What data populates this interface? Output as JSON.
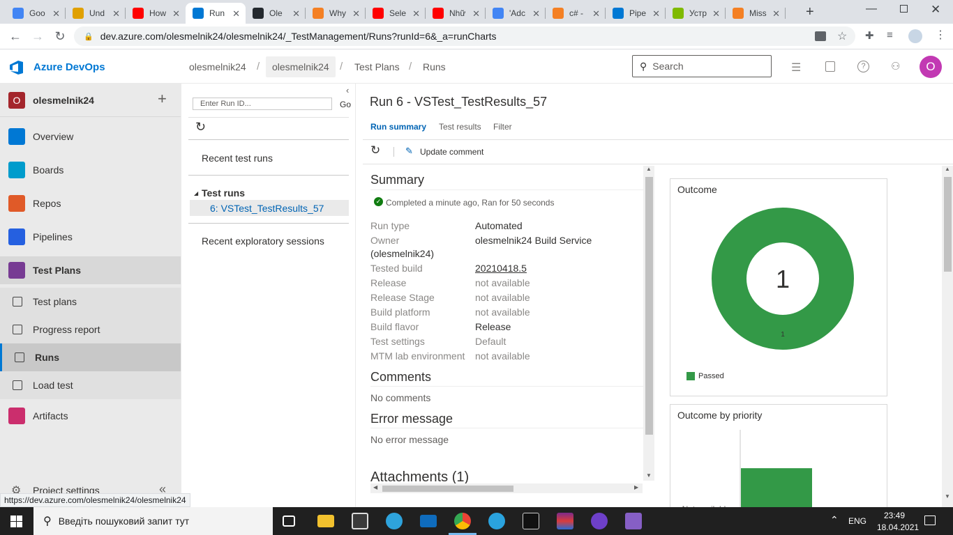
{
  "browser": {
    "tabs": [
      {
        "label": "Goo",
        "icon": "google-g-icon",
        "color": "#4285f4"
      },
      {
        "label": "Und",
        "icon": "chrome-icon",
        "color": "#e0a000"
      },
      {
        "label": "How",
        "icon": "youtube-icon",
        "color": "#ff0000"
      },
      {
        "label": "Run",
        "icon": "azure-devops-icon",
        "color": "#0078d4",
        "active": true
      },
      {
        "label": "Ole",
        "icon": "github-icon",
        "color": "#24292e"
      },
      {
        "label": "Why",
        "icon": "stackoverflow-icon",
        "color": "#f48024"
      },
      {
        "label": "Sele",
        "icon": "youtube-icon",
        "color": "#ff0000"
      },
      {
        "label": "Nhữ",
        "icon": "youtube-icon",
        "color": "#ff0000"
      },
      {
        "label": "'Adc",
        "icon": "google-g-icon",
        "color": "#4285f4"
      },
      {
        "label": "c# -",
        "icon": "stackoverflow-icon",
        "color": "#f48024"
      },
      {
        "label": "Pipe",
        "icon": "azure-devops-icon",
        "color": "#0078d4"
      },
      {
        "label": "Устр",
        "icon": "microsoft-icon",
        "color": "#7fba00"
      },
      {
        "label": "Miss",
        "icon": "stackoverflow-icon",
        "color": "#f48024"
      }
    ],
    "url": "dev.azure.com/olesmelnik24/olesmelnik24/_TestManagement/Runs?runId=6&_a=runCharts",
    "status_url": "https://dev.azure.com/olesmelnik24/olesmelnik24"
  },
  "header": {
    "product": "Azure DevOps",
    "breadcrumbs": [
      "olesmelnik24",
      "olesmelnik24",
      "Test Plans",
      "Runs"
    ],
    "search_placeholder": "Search",
    "avatar_letter": "O"
  },
  "sidebar": {
    "project": "olesmelnik24",
    "project_letter": "O",
    "items": [
      {
        "label": "Overview",
        "icon": "overview-icon",
        "color": "#0078d4"
      },
      {
        "label": "Boards",
        "icon": "boards-icon",
        "color": "#009ccc"
      },
      {
        "label": "Repos",
        "icon": "repos-icon",
        "color": "#e05a28"
      },
      {
        "label": "Pipelines",
        "icon": "pipelines-icon",
        "color": "#2560e0"
      },
      {
        "label": "Test Plans",
        "icon": "test-plans-icon",
        "color": "#773b93"
      }
    ],
    "subitems": [
      {
        "label": "Test plans",
        "icon": "test-plans-list-icon"
      },
      {
        "label": "Progress report",
        "icon": "progress-report-icon"
      },
      {
        "label": "Runs",
        "icon": "runs-icon"
      },
      {
        "label": "Load test",
        "icon": "load-test-icon"
      }
    ],
    "artifacts": {
      "label": "Artifacts",
      "icon": "artifacts-icon",
      "color": "#cb2e6d"
    },
    "settings": "Project settings"
  },
  "leftpanel": {
    "run_id_placeholder": "Enter Run ID...",
    "go_label": "Go",
    "recent_runs": "Recent test runs",
    "test_runs_header": "Test runs",
    "selected_run": "6: VSTest_TestResults_57",
    "recent_exploratory": "Recent exploratory sessions"
  },
  "content": {
    "title": "Run 6 - VSTest_TestResults_57",
    "tabs": [
      "Run summary",
      "Test results",
      "Filter"
    ],
    "update_comment": "Update comment",
    "summary_heading": "Summary",
    "status_text": "Completed a minute ago, Ran for 50 seconds",
    "fields": [
      {
        "label": "Run type",
        "value": "Automated"
      },
      {
        "label": "Owner",
        "value": "olesmelnik24 Build Service",
        "extra": "(olesmelnik24)"
      },
      {
        "label": "Tested build",
        "value": "20210418.5",
        "link": true
      },
      {
        "label": "Release",
        "value": "not available",
        "muted": true
      },
      {
        "label": "Release Stage",
        "value": "not available",
        "muted": true
      },
      {
        "label": "Build platform",
        "value": "not available",
        "muted": true
      },
      {
        "label": "Build flavor",
        "value": "Release"
      },
      {
        "label": "Test settings",
        "value": "Default",
        "muted": true
      },
      {
        "label": "MTM lab environment",
        "value": "not available",
        "muted": true
      }
    ],
    "comments_heading": "Comments",
    "comments_text": "No comments",
    "error_heading": "Error message",
    "error_text": "No error message",
    "attachments_heading": "Attachments (1)"
  },
  "chart_data": [
    {
      "type": "pie",
      "title": "Outcome",
      "center_label": "1",
      "categories": [
        "Passed"
      ],
      "values": [
        1
      ],
      "slice_labels": [
        "1"
      ],
      "colors": [
        "#339947"
      ]
    },
    {
      "type": "bar",
      "title": "Outcome by priority",
      "categories": [
        "Not available"
      ],
      "values": [
        1
      ],
      "colors": [
        "#339947"
      ]
    }
  ],
  "taskbar": {
    "search_placeholder": "Введіть пошуковий запит тут",
    "lang": "ENG",
    "time": "23:49",
    "date": "18.04.2021"
  }
}
